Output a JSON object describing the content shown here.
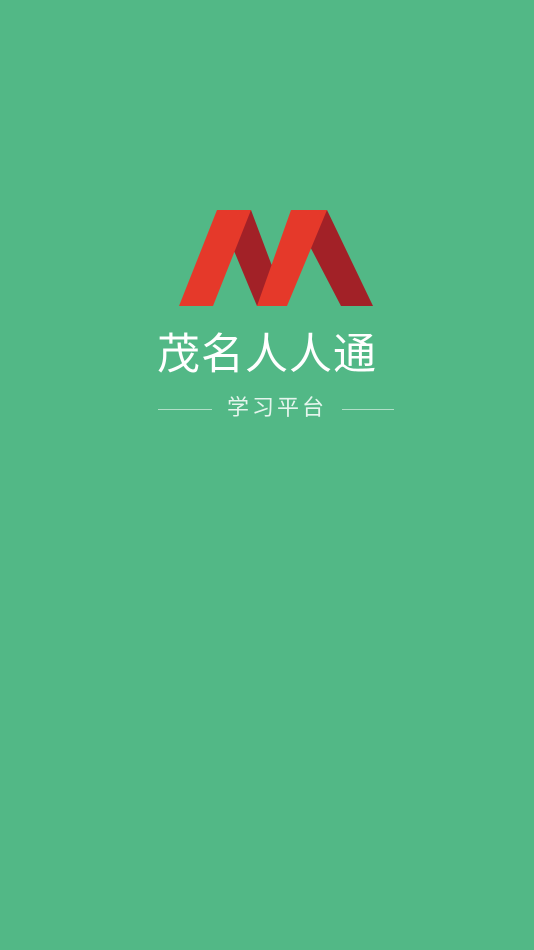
{
  "app": {
    "name": "茂名人人通",
    "subtitle": "学习平台",
    "logo_icon": "m-ribbon-logo-icon"
  },
  "colors": {
    "background": "#52B886",
    "logo_red": "#E5392A",
    "logo_dark_red": "#A22127",
    "text": "#FFFFFF"
  }
}
